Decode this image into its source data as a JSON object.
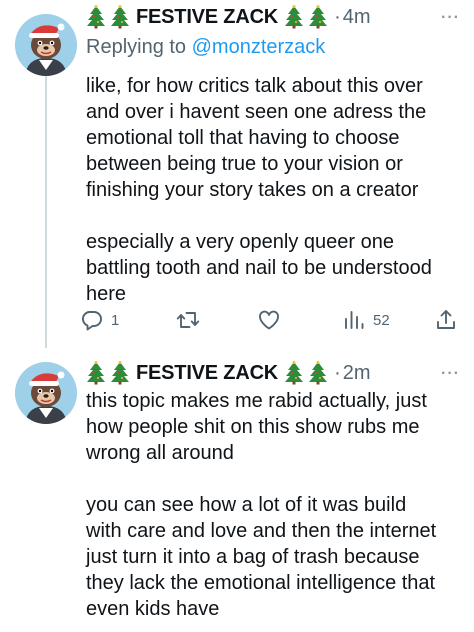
{
  "tweets": [
    {
      "display_name": "FESTIVE ZACK",
      "separator": "·",
      "time": "4m",
      "more": "···",
      "replying_prefix": "Replying to ",
      "replying_handle": "@monzterzack",
      "paragraphs": [
        [
          "like, for how critics talk about this over",
          "and over i havent seen one adress the",
          "emotional toll that having to choose",
          "between being true to your vision or",
          "finishing your story takes on a creator"
        ],
        [
          "especially a very openly queer one",
          "battling tooth and nail to be understood",
          "here"
        ]
      ],
      "actions": {
        "reply_count": "1",
        "views_count": "52"
      }
    },
    {
      "display_name": "FESTIVE ZACK",
      "separator": "·",
      "time": "2m",
      "more": "···",
      "paragraphs": [
        [
          "this topic makes me rabid actually, just",
          "how people shit on this show rubs me",
          "wrong all around"
        ],
        [
          "you can see how a lot of it was build",
          "with care and love and then the internet",
          "just turn it into a bag of trash because",
          "they lack the emotional intelligence that",
          "even kids have"
        ]
      ]
    }
  ],
  "icons": {
    "name_decoration": "christmas-tree-icon",
    "reply": "reply-icon",
    "retweet": "retweet-icon",
    "like": "heart-icon",
    "views": "analytics-icon",
    "share": "share-icon"
  },
  "colors": {
    "link": "#1d9bf0",
    "secondary_text": "#536471",
    "avatar_bg": "#9ed0ea",
    "thread_line": "#cfd9de"
  }
}
